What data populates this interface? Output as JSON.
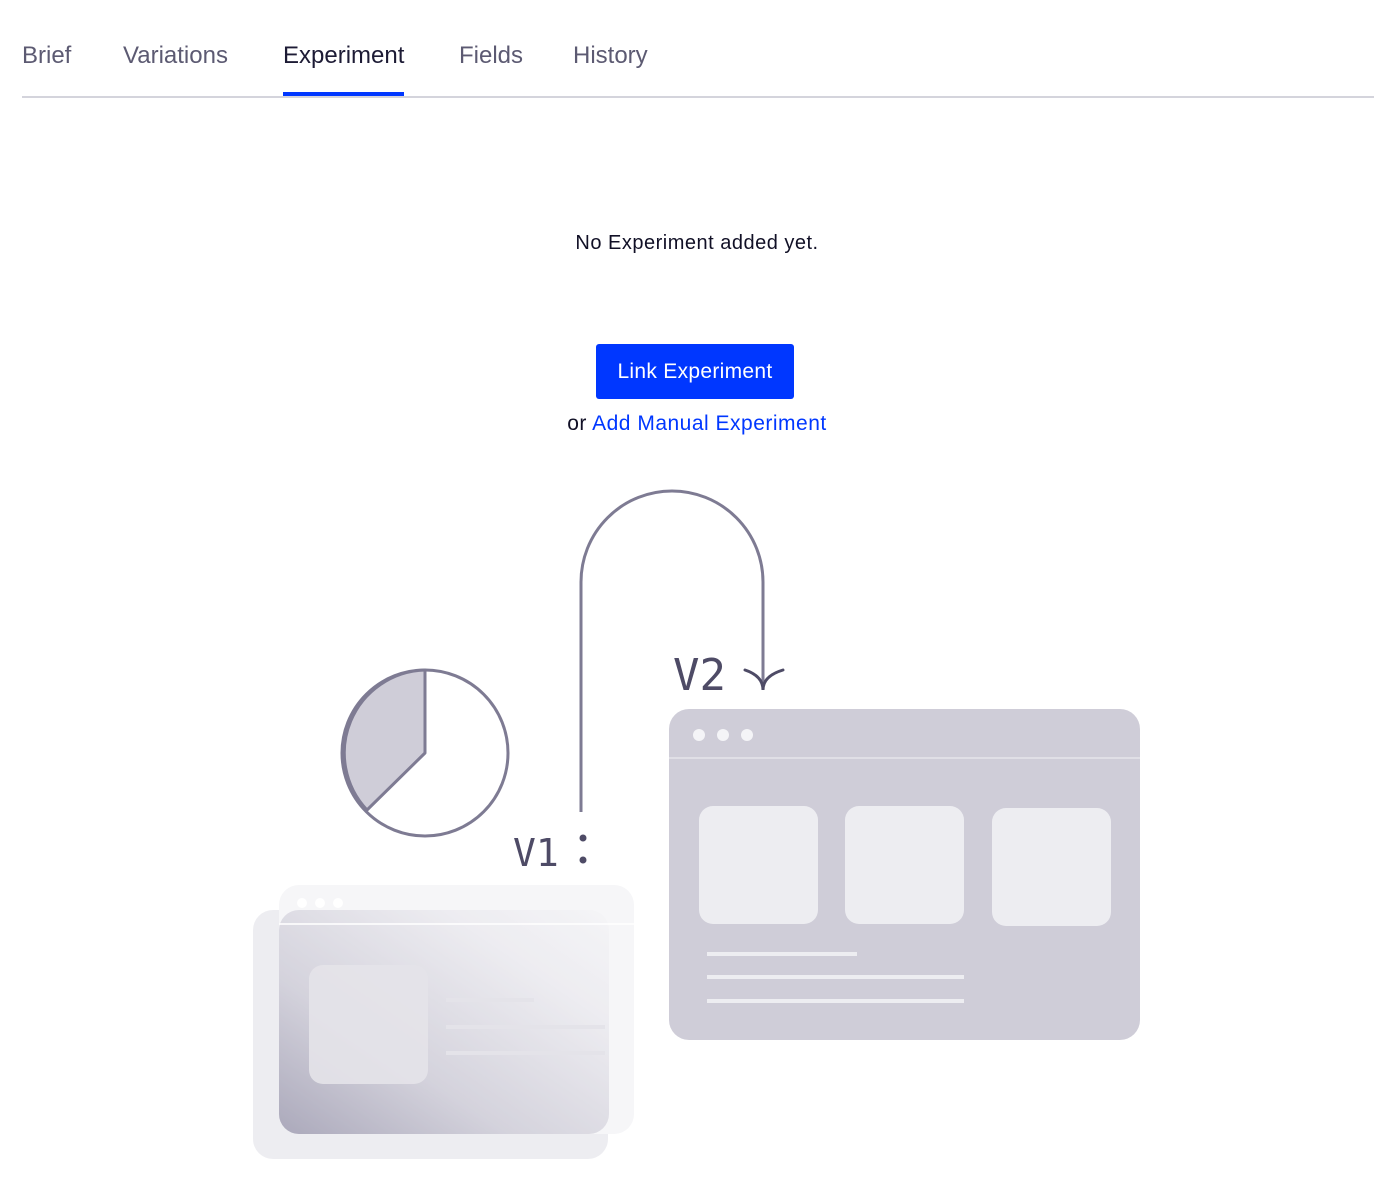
{
  "tabs": [
    {
      "label": "Brief",
      "active": false
    },
    {
      "label": "Variations",
      "active": false
    },
    {
      "label": "Experiment",
      "active": true
    },
    {
      "label": "Fields",
      "active": false
    },
    {
      "label": "History",
      "active": false
    }
  ],
  "empty_state": {
    "message": "No Experiment added yet.",
    "primary_button": "Link Experiment",
    "alt_prefix": "or",
    "alt_link": "Add Manual Experiment"
  },
  "illustration": {
    "v1_label": "V1",
    "v2_label": "V2"
  },
  "colors": {
    "accent": "#0037ff",
    "illustration_stroke": "#7e7b93",
    "illustration_fill": "#cfcdd8"
  }
}
